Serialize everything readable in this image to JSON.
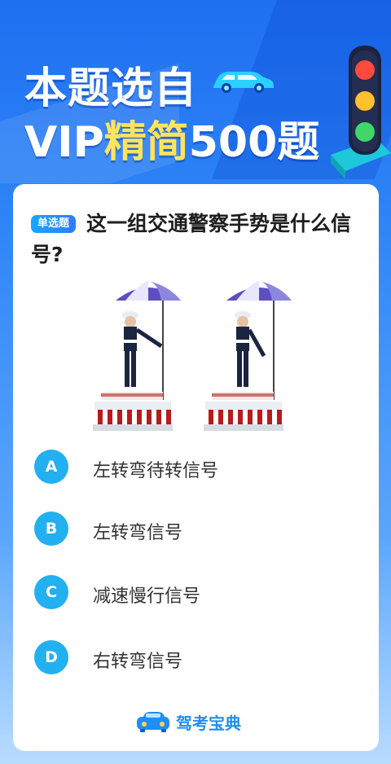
{
  "header": {
    "title_line1": "本题选自",
    "title_vip": "VIP",
    "title_highlight": "精简",
    "title_rest": "500题",
    "car_icon": "car-icon",
    "traffic_light_icon": "traffic-light-icon"
  },
  "question": {
    "badge": "单选题",
    "text": "这一组交通警察手势是什么信号?",
    "image": "traffic-police-gesture-illustration"
  },
  "options": [
    {
      "letter": "A",
      "text": "左转弯待转信号"
    },
    {
      "letter": "B",
      "text": "左转弯信号"
    },
    {
      "letter": "C",
      "text": "减速慢行信号"
    },
    {
      "letter": "D",
      "text": "右转弯信号"
    }
  ],
  "brand": {
    "name": "驾考宝典",
    "icon": "car-logo-icon"
  },
  "colors": {
    "accent": "#22b0f0",
    "highlight": "#ffe45c",
    "brand": "#1f8ef5"
  }
}
